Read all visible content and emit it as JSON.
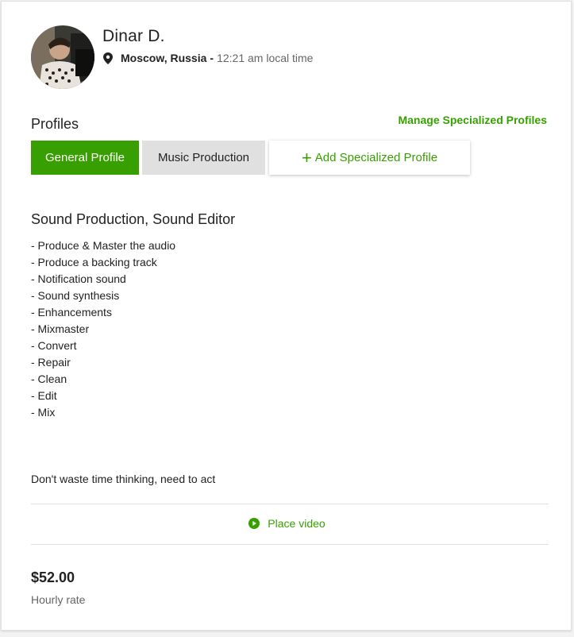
{
  "profile": {
    "name": "Dinar D.",
    "city": "Moscow, Russia",
    "dash": "-",
    "local_time": "12:21 am local time"
  },
  "profiles_section": {
    "title": "Profiles",
    "manage_link": "Manage Specialized Profiles",
    "tabs": {
      "general": "General Profile",
      "music": "Music Production",
      "add": "Add Specialized Profile",
      "add_icon": "+"
    }
  },
  "overview": {
    "title": "Sound Production, Sound Editor",
    "items": [
      "- Produce & Master the audio",
      "- Produce a backing track",
      "- Notification sound",
      "- Sound synthesis",
      "- Enhancements",
      "- Mixmaster",
      "- Convert",
      "- Repair",
      "- Clean",
      "- Edit",
      "- Mix"
    ],
    "tagline": "Don't waste time thinking, need to act"
  },
  "video": {
    "label": "Place video",
    "icon": "play-circle-icon"
  },
  "rate": {
    "amount": "$52.00",
    "label": "Hourly rate"
  },
  "colors": {
    "accent": "#37a000",
    "tab_inactive": "#e0e0e0"
  }
}
